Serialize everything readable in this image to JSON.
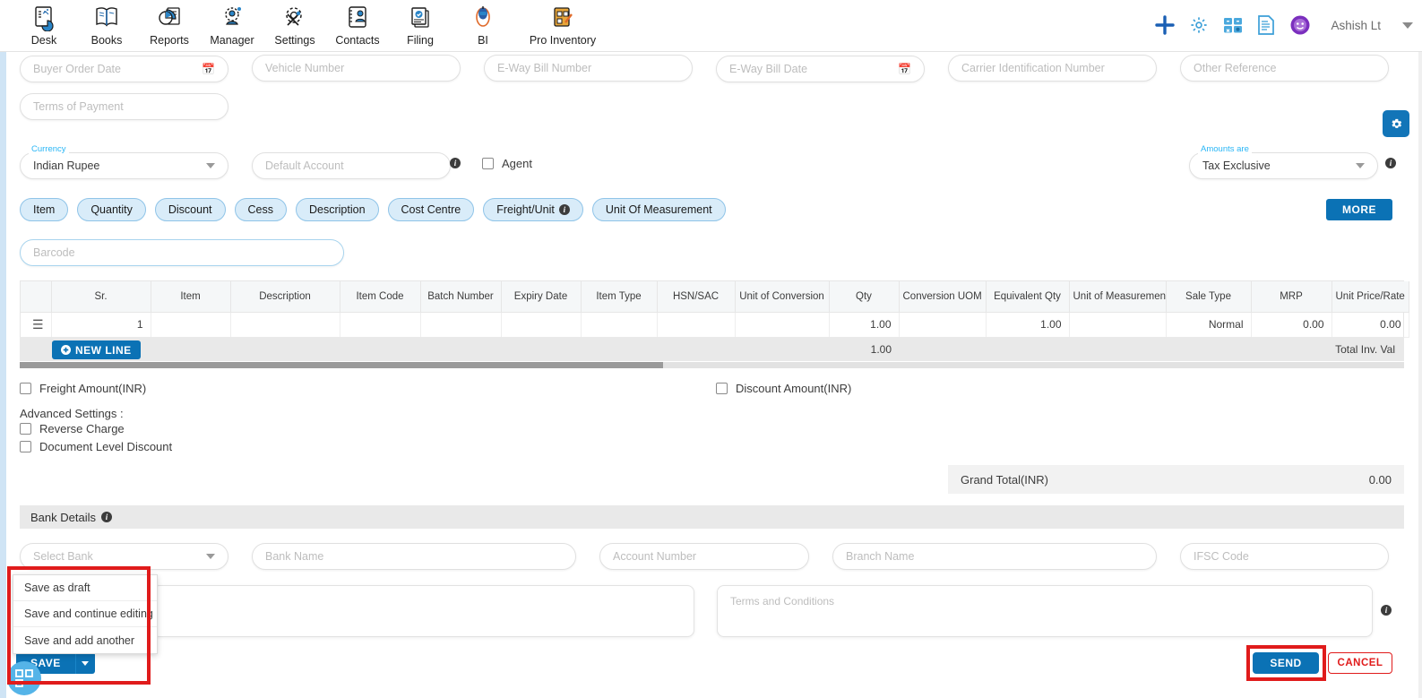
{
  "topnav": {
    "items": [
      {
        "label": "Desk",
        "icon": "desk-chart-icon"
      },
      {
        "label": "Books",
        "icon": "books-icon"
      },
      {
        "label": "Reports",
        "icon": "reports-pie-icon"
      },
      {
        "label": "Manager",
        "icon": "manager-gear-people-icon"
      },
      {
        "label": "Settings",
        "icon": "settings-gear-tools-icon"
      },
      {
        "label": "Contacts",
        "icon": "contacts-card-icon"
      },
      {
        "label": "Filing",
        "icon": "filing-documents-icon"
      },
      {
        "label": "BI",
        "icon": "bi-robot-icon"
      },
      {
        "label": "Pro Inventory",
        "icon": "pro-inventory-clipboard-icon"
      }
    ],
    "right_icons": [
      {
        "name": "plus-icon",
        "color": "#1a5fb4"
      },
      {
        "name": "gear-icon",
        "color": "#3b9fd8"
      },
      {
        "name": "calculator-icon",
        "color": "#3b9fd8"
      },
      {
        "name": "document-icon",
        "color": "#3b9fd8"
      },
      {
        "name": "smiley-badge-icon",
        "color": "#7b2fbe"
      }
    ],
    "user": "Ashish Lt"
  },
  "form": {
    "row1": [
      {
        "placeholder": "Buyer Order Date",
        "type": "date"
      },
      {
        "placeholder": "Vehicle Number",
        "type": "text"
      },
      {
        "placeholder": "E-Way Bill Number",
        "type": "text"
      },
      {
        "placeholder": "E-Way Bill Date",
        "type": "date"
      },
      {
        "placeholder": "Carrier Identification Number",
        "type": "text"
      },
      {
        "placeholder": "Other Reference",
        "type": "text"
      }
    ],
    "terms_of_payment": {
      "placeholder": "Terms of Payment"
    },
    "currency": {
      "label": "Currency",
      "value": "Indian Rupee"
    },
    "default_account": {
      "placeholder": "Default Account"
    },
    "agent": {
      "label": "Agent",
      "checked": false
    },
    "amounts_are": {
      "label": "Amounts are",
      "value": "Tax Exclusive"
    },
    "gear_button": "gear-icon"
  },
  "chips": [
    {
      "label": "Item",
      "info": false
    },
    {
      "label": "Quantity",
      "info": false
    },
    {
      "label": "Discount",
      "info": false
    },
    {
      "label": "Cess",
      "info": false
    },
    {
      "label": "Description",
      "info": false
    },
    {
      "label": "Cost Centre",
      "info": false
    },
    {
      "label": "Freight/Unit",
      "info": true
    },
    {
      "label": "Unit Of Measurement",
      "info": false
    }
  ],
  "more_button": "MORE",
  "barcode": {
    "placeholder": "Barcode"
  },
  "table": {
    "columns": [
      "",
      "Sr.",
      "Item",
      "Description",
      "Item Code",
      "Batch Number",
      "Expiry Date",
      "Item Type",
      "HSN/SAC",
      "Unit of Conversion",
      "Qty",
      "Conversion UOM",
      "Equivalent Qty",
      "Unit of Measurement",
      "Sale Type",
      "MRP",
      "Unit Price/Rate"
    ],
    "rows": [
      {
        "handle": "drag-handle-icon",
        "sr": "1",
        "item": "",
        "description": "",
        "item_code": "",
        "batch_number": "",
        "expiry_date": "",
        "item_type": "",
        "hsn_sac": "",
        "unit_of_conversion": "",
        "qty": "1.00",
        "conversion_uom": "",
        "equivalent_qty": "1.00",
        "unit_of_measurement": "",
        "sale_type": "Normal",
        "mrp": "0.00",
        "unit_price_rate": "0.00"
      }
    ],
    "totals": {
      "qty": "1.00",
      "label": "Total Inv. Val"
    },
    "new_line_button": "NEW LINE"
  },
  "amount_checks": {
    "freight": {
      "label": "Freight Amount(INR)",
      "checked": false
    },
    "discount": {
      "label": "Discount Amount(INR)",
      "checked": false
    }
  },
  "advanced_settings": {
    "title": "Advanced Settings :",
    "options": [
      {
        "label": "Reverse Charge",
        "checked": false
      },
      {
        "label": "Document Level Discount",
        "checked": false
      }
    ]
  },
  "grand_total": {
    "label": "Grand Total(INR)",
    "value": "0.00"
  },
  "bank_details": {
    "title": "Bank Details",
    "fields": [
      {
        "placeholder": "Select Bank",
        "type": "select"
      },
      {
        "placeholder": "Bank Name",
        "type": "text"
      },
      {
        "placeholder": "Account Number",
        "type": "text"
      },
      {
        "placeholder": "Branch Name",
        "type": "text"
      },
      {
        "placeholder": "IFSC Code",
        "type": "text"
      }
    ]
  },
  "notes": {
    "placeholder": ""
  },
  "terms_conditions": {
    "placeholder": "Terms and Conditions"
  },
  "save_menu": {
    "button_label": "SAVE",
    "items": [
      "Save as draft",
      "Save and continue editing",
      "Save and add another"
    ]
  },
  "actions": {
    "send": "SEND",
    "cancel": "CANCEL"
  },
  "colors": {
    "accent_blue": "#0b72b5",
    "highlight_red": "#e01b1b",
    "chip_blue": "#d9ecf9",
    "label_blue": "#29b6f6"
  }
}
